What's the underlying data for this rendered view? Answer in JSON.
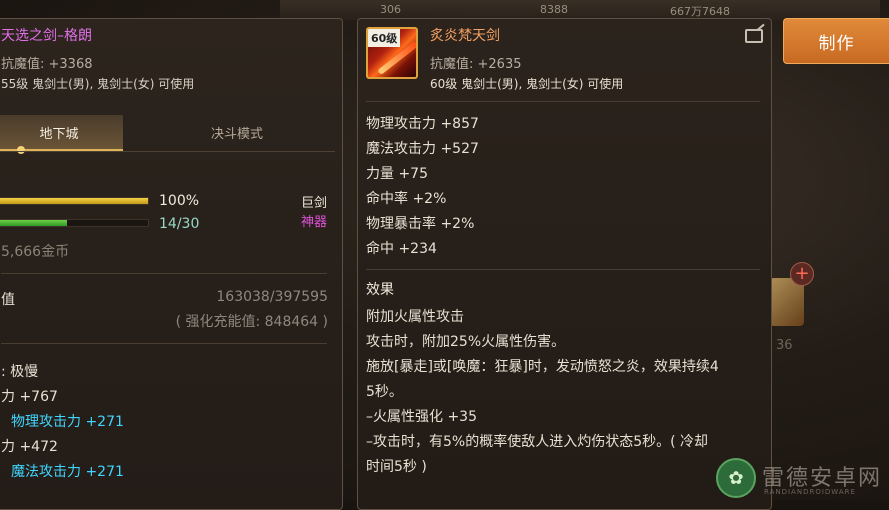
{
  "top_strip": {
    "a": "306",
    "b": "8388",
    "c": "667万7648"
  },
  "make_button": "制作",
  "left": {
    "title": "天选之剑–格朗",
    "stat": "抗魔值: +3368",
    "req": "55级 鬼剑士(男), 鬼剑士(女) 可使用",
    "tabs": [
      "地下城",
      "决斗模式"
    ],
    "bar1_pct": "100%",
    "bar1_fill": 1.0,
    "bar2_frac": "14/30",
    "bar2_fill": 0.467,
    "tag_big": "巨剑",
    "tag_god": "神器",
    "gold": "5,666金币",
    "value_label": "值",
    "value_num": "163038/397595",
    "value_sub": "( 强化充能值: 848464 )",
    "speed": ": 极慢",
    "phys": "力 +767",
    "phys_bonus": "物理攻击力 +271",
    "mag": "力 +472",
    "mag_bonus": "魔法攻击力 +271"
  },
  "right": {
    "level_badge": "60级",
    "title": "炙炎梵天剑",
    "stat": "抗魔值: +2635",
    "req": "60级 鬼剑士(男), 鬼剑士(女) 可使用",
    "stats": [
      "物理攻击力 +857",
      "魔法攻击力 +527",
      "力量 +75",
      "命中率 +2%",
      "物理暴击率 +2%",
      "命中 +234"
    ],
    "effect_title": "效果",
    "effects": [
      "附加火属性攻击",
      "攻击时，附加25%火属性伤害。",
      "施放[暴走]或[唤魔：狂暴]时，发动愤怒之炎，效果持续4",
      "5秒。",
      "–火属性强化 +35",
      "–攻击时，有5%的概率使敌人进入灼伤状态5秒。( 冷却",
      "时间5秒 )"
    ]
  },
  "side_count": "36",
  "watermark": {
    "text": "雷德安卓网",
    "sub": "RANDIANDROIDWARE"
  }
}
